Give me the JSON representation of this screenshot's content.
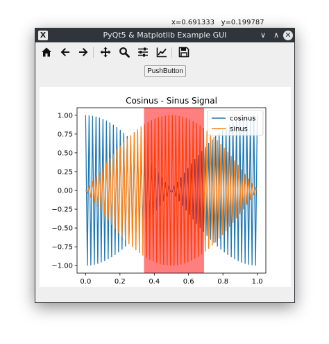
{
  "window": {
    "title": "PyQt5 & Matplotlib Example GUI",
    "app_icon_glyph": "X",
    "buttons": {
      "minimize": "∨",
      "maximize": "∧",
      "close": "✕"
    }
  },
  "toolbar": {
    "items": [
      "home-icon",
      "back-arrow-icon",
      "forward-arrow-icon",
      "pan-icon",
      "zoom-icon",
      "subplots-config-icon",
      "edit-axis-icon",
      "save-icon"
    ],
    "coords": {
      "x": "x=0.691333",
      "y": "y=0.199787"
    }
  },
  "push_button": {
    "label": "PushButton"
  },
  "chart_data": {
    "type": "line",
    "title": "Cosinus - Sinus Signal",
    "xlabel": "",
    "ylabel": "",
    "xlim": [
      -0.05,
      1.05
    ],
    "ylim": [
      -1.1,
      1.1
    ],
    "xticks": [
      "0.0",
      "0.2",
      "0.4",
      "0.6",
      "0.8",
      "1.0"
    ],
    "yticks": [
      "1.00",
      "0.75",
      "0.50",
      "0.25",
      "0.00",
      "−0.25",
      "−0.50",
      "−0.75",
      "−1.00"
    ],
    "series": [
      {
        "name": "cosinus",
        "color": "#1f77b4",
        "function": "cos(2*pi*50*t)"
      },
      {
        "name": "sinus",
        "color": "#ff7f0e",
        "function": "sin(2*pi*50*t)"
      }
    ],
    "samples": 100,
    "x_range": [
      0,
      1
    ],
    "highlight_span": {
      "x0": 0.34,
      "x1": 0.69,
      "color": "#ff0000",
      "alpha": 0.5
    },
    "legend": "upper right",
    "grid": false
  }
}
